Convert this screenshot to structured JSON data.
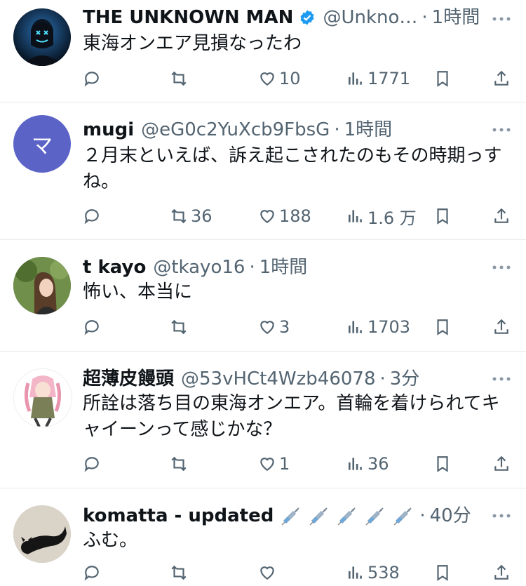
{
  "tweets": [
    {
      "name": "THE UNKNOWN MAN",
      "verified": true,
      "handle": "@Unkno…",
      "time": "1時間",
      "text_lines": [
        "東海オンエア見損なったわ"
      ],
      "avatar_text": "THE UNKNOWN MAN",
      "stats": {
        "reply": "",
        "retweet": "",
        "like": "10",
        "views": "1771"
      }
    },
    {
      "name": "mugi",
      "handle": "@eG0c2YuXcb9FbsG",
      "time": "1時間",
      "text_lines": [
        "２月末といえば、訴え起こされたのもその時期っす",
        "ね。"
      ],
      "avatar_text": "マ",
      "stats": {
        "reply": "",
        "retweet": "36",
        "like": "188",
        "views": "1.6 万"
      }
    },
    {
      "name": "t kayo",
      "handle": "@tkayo16",
      "time": "1時間",
      "text_lines": [
        "怖い、本当に"
      ],
      "stats": {
        "reply": "",
        "retweet": "",
        "like": "3",
        "views": "1703"
      }
    },
    {
      "name": "超薄皮饅頭",
      "handle": "@53vHCt4Wzb46078",
      "time": "3分",
      "text_lines": [
        "所詮は落ち目の東海オンエア。首輪を着けられてキ",
        "ャイーンって感じかな？"
      ],
      "stats": {
        "reply": "",
        "retweet": "",
        "like": "1",
        "views": "36"
      }
    },
    {
      "name": "komatta - updated",
      "handle": "",
      "time": "40分",
      "text_lines": [
        "ふむ。"
      ],
      "stats": {
        "reply": "",
        "retweet": "",
        "like": "",
        "views": "538"
      }
    }
  ],
  "colors": {
    "text": "#0f1419",
    "secondary": "#536471",
    "verified": "#1d9bf0",
    "divider": "#e7e9ea",
    "mugi_avatar": "#5b63c7"
  }
}
